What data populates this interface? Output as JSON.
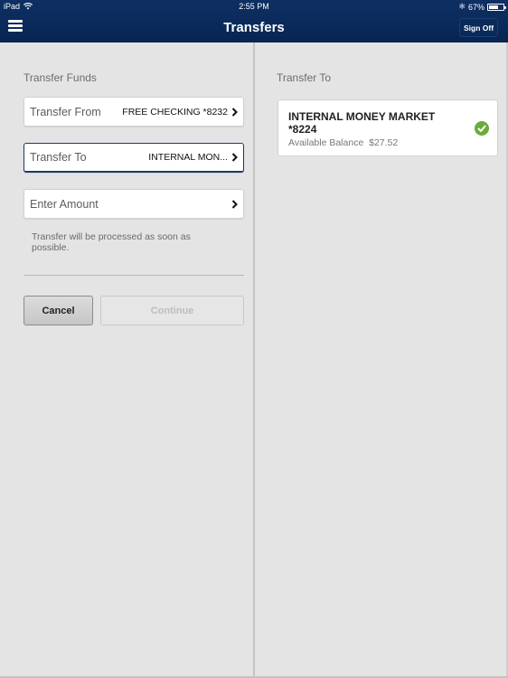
{
  "status_bar": {
    "device": "iPad",
    "time": "2:55 PM",
    "battery_percent_label": "67%",
    "battery_level": 0.67,
    "icons": [
      "wifi-icon",
      "bluetooth-icon",
      "battery-icon"
    ]
  },
  "header": {
    "title": "Transfers",
    "menu_icon": "hamburger-menu-icon",
    "sign_off_label": "Sign Off"
  },
  "left_pane": {
    "section_label": "Transfer Funds",
    "rows": [
      {
        "label": "Transfer From",
        "value": "FREE CHECKING *8232",
        "icon": "chevron-right-icon"
      },
      {
        "label": "Transfer To",
        "value": "INTERNAL MON...",
        "icon": "chevron-right-icon",
        "selected": true
      },
      {
        "label": "Enter Amount",
        "value": "",
        "icon": "chevron-right-icon"
      }
    ],
    "note": "Transfer will be processed as soon as possible.",
    "cancel_label": "Cancel",
    "continue_label": "Continue"
  },
  "right_pane": {
    "section_label": "Transfer To",
    "account": {
      "name": "INTERNAL MONEY MARKET *8224",
      "balance_label": "Available Balance",
      "balance_value": "$27.52",
      "balance_text": "Available Balance  $27.52",
      "selected_icon": "checkmark-circle-icon"
    }
  },
  "colors": {
    "header_bg": "#0a2a5a",
    "check_green": "#6aab3c",
    "selected_border": "#1d3a6a"
  }
}
